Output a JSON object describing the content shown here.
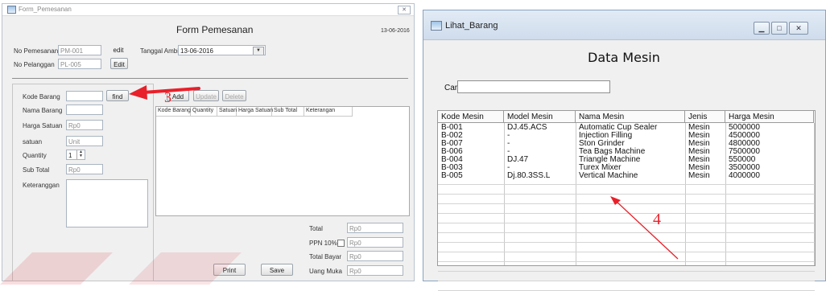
{
  "left": {
    "title": "Form_Pemesanan",
    "heading": "Form Pemesanan",
    "date_display": "13-06-2016",
    "no_pemesanan_label": "No Pemesanan",
    "no_pemesanan_value": "PM-001",
    "edit_btn1": "edit",
    "no_pelanggan_label": "No Pelanggan",
    "no_pelanggan_value": "PL-005",
    "edit_btn2": "Edit",
    "tanggal_label": "Tanggal Ambil",
    "tanggal_value": "13-06-2016",
    "kode_label": "Kode Barang",
    "kode_value": "",
    "find_btn": "find",
    "nama_label": "Nama Barang",
    "nama_value": "",
    "harga_label": "Harga Satuan",
    "harga_value": "Rp0",
    "satuan_label": "satuan",
    "satuan_value": "Unit",
    "qty_label": "Quantity",
    "qty_value": "1",
    "subtotal_label": "Sub Total",
    "subtotal_value": "Rp0",
    "ket_label": "Keteranggan",
    "add_btn": "Add",
    "update_btn": "Update",
    "delete_btn": "Delete",
    "grid_headers": [
      "Kode Barang",
      "Quantity",
      "Satuan",
      "Harga Satuan",
      "Sub Total",
      "Keterangan"
    ],
    "total_label": "Total",
    "total_value": "Rp0",
    "ppn_label": "PPN 10%",
    "ppn_value": "Rp0",
    "totalbayar_label": "Total Bayar",
    "totalbayar_value": "Rp0",
    "uangmuka_label": "Uang Muka",
    "uangmuka_value": "Rp0",
    "print_btn": "Print",
    "save_btn": "Save",
    "annotation": "3"
  },
  "right": {
    "title": "Lihat_Barang",
    "heading": "Data Mesin",
    "cari_label": "Cari",
    "cari_value": "",
    "columns": [
      "Kode Mesin",
      "Model Mesin",
      "Nama Mesin",
      "Jenis",
      "Harga Mesin"
    ],
    "rows": [
      [
        "B-001",
        "DJ.45.ACS",
        "Automatic Cup Sealer",
        "Mesin",
        "5000000"
      ],
      [
        "B-002",
        "-",
        "Injection Filling",
        "Mesin",
        "4500000"
      ],
      [
        "B-007",
        "-",
        "Ston Grinder",
        "Mesin",
        "4800000"
      ],
      [
        "B-006",
        "-",
        "Tea Bags Machine",
        "Mesin",
        "7500000"
      ],
      [
        "B-004",
        "DJ.47",
        "Triangle Machine",
        "Mesin",
        "550000"
      ],
      [
        "B-003",
        "-",
        "Turex Mixer",
        "Mesin",
        "3500000"
      ],
      [
        "B-005",
        "Dj.80.3SS.L",
        "Vertical Machine",
        "Mesin",
        "4000000"
      ]
    ],
    "annotation": "4"
  },
  "colors": {
    "arrow": "#e8202a",
    "titlebar": "#dfe9f5",
    "panel": "#f0f0f0"
  }
}
